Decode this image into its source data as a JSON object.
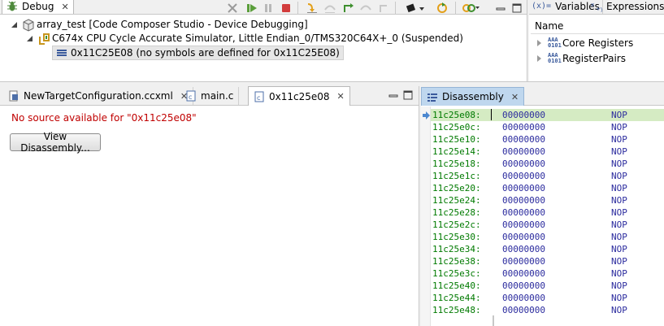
{
  "debug_view": {
    "tab_label": "Debug",
    "tree": {
      "project": "array_test [Code Composer Studio - Device Debugging]",
      "target": "C674x CPU Cycle Accurate Simulator, Little Endian_0/TMS320C64X+_0 (Suspended)",
      "frame": "0x11C25E08  (no symbols are defined for 0x11C25E08)"
    }
  },
  "variables_view": {
    "tabs": [
      "Variables",
      "Expressions"
    ],
    "column_header": "Name",
    "items": [
      "Core Registers",
      "RegisterPairs"
    ]
  },
  "editor": {
    "tabs": [
      "NewTargetConfiguration.ccxml",
      "main.c",
      "0x11c25e08"
    ],
    "message": "No source available for \"0x11c25e08\"",
    "button_label": "View Disassembly..."
  },
  "disassembly": {
    "tab_label": "Disassembly",
    "rows": [
      {
        "addr": "11c25e08:",
        "opcode": "00000000",
        "mnemonic": "NOP"
      },
      {
        "addr": "11c25e0c:",
        "opcode": "00000000",
        "mnemonic": "NOP"
      },
      {
        "addr": "11c25e10:",
        "opcode": "00000000",
        "mnemonic": "NOP"
      },
      {
        "addr": "11c25e14:",
        "opcode": "00000000",
        "mnemonic": "NOP"
      },
      {
        "addr": "11c25e18:",
        "opcode": "00000000",
        "mnemonic": "NOP"
      },
      {
        "addr": "11c25e1c:",
        "opcode": "00000000",
        "mnemonic": "NOP"
      },
      {
        "addr": "11c25e20:",
        "opcode": "00000000",
        "mnemonic": "NOP"
      },
      {
        "addr": "11c25e24:",
        "opcode": "00000000",
        "mnemonic": "NOP"
      },
      {
        "addr": "11c25e28:",
        "opcode": "00000000",
        "mnemonic": "NOP"
      },
      {
        "addr": "11c25e2c:",
        "opcode": "00000000",
        "mnemonic": "NOP"
      },
      {
        "addr": "11c25e30:",
        "opcode": "00000000",
        "mnemonic": "NOP"
      },
      {
        "addr": "11c25e34:",
        "opcode": "00000000",
        "mnemonic": "NOP"
      },
      {
        "addr": "11c25e38:",
        "opcode": "00000000",
        "mnemonic": "NOP"
      },
      {
        "addr": "11c25e3c:",
        "opcode": "00000000",
        "mnemonic": "NOP"
      },
      {
        "addr": "11c25e40:",
        "opcode": "00000000",
        "mnemonic": "NOP"
      },
      {
        "addr": "11c25e44:",
        "opcode": "00000000",
        "mnemonic": "NOP"
      },
      {
        "addr": "11c25e48:",
        "opcode": "00000000",
        "mnemonic": "NOP"
      }
    ]
  },
  "colors": {
    "current_line": "#cfe7b8",
    "address": "#007a00",
    "opcode": "#2b2b9e",
    "error_text": "#c00000"
  }
}
